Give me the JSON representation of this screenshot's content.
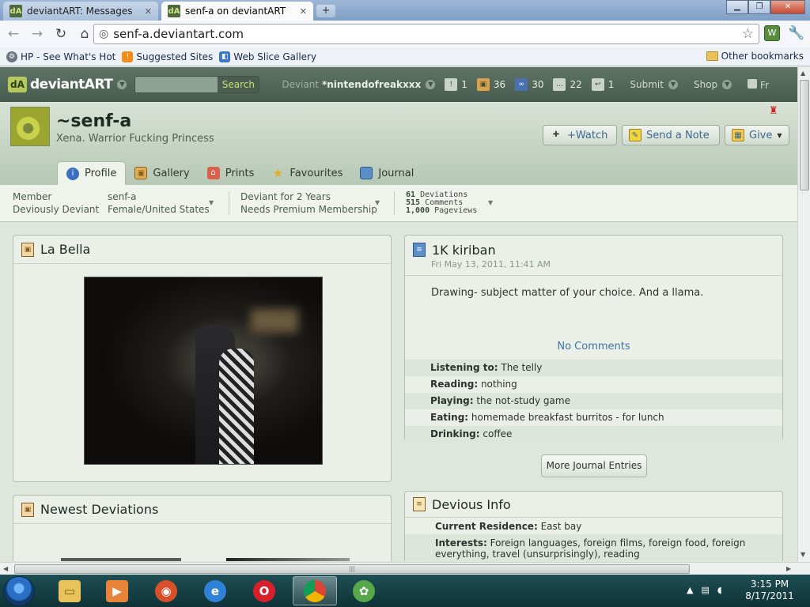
{
  "browser": {
    "tabs": [
      {
        "label": "deviantART: Messages",
        "active": false
      },
      {
        "label": "senf-a on deviantART",
        "active": true
      }
    ],
    "url": "senf-a.deviantart.com",
    "bookmarks": [
      "HP - See What's Hot",
      "Suggested Sites",
      "Web Slice Gallery"
    ],
    "other_bookmarks": "Other bookmarks"
  },
  "da_bar": {
    "logo": "deviantART",
    "search_button": "Search",
    "user_prefix": "Deviant",
    "username": "*nintendofreakxxx",
    "counts": [
      "1",
      "36",
      "30",
      "22",
      "1"
    ],
    "submit": "Submit",
    "shop": "Shop",
    "overflow": "Fr"
  },
  "profile": {
    "name": "~senf-a",
    "tagline": "Xena. Warrior Fucking Princess",
    "buttons": {
      "watch": "+Watch",
      "note": "Send a Note",
      "give": "Give"
    },
    "tabs": [
      "Profile",
      "Gallery",
      "Prints",
      "Favourites",
      "Journal"
    ]
  },
  "stats": {
    "member_line1": "Member",
    "member_line2": "Deviously Deviant",
    "user_line1": "senf-a",
    "user_line2": "Female/United States",
    "deviant_line1": "Deviant for 2 Years",
    "deviant_line2": "Needs Premium Membership",
    "deviations": "61",
    "deviations_label": "Deviations",
    "comments": "515",
    "comments_label": "Comments",
    "pageviews": "1,000",
    "pageviews_label": "Pageviews"
  },
  "featured": {
    "title": "La Bella"
  },
  "newest": {
    "title": "Newest Deviations"
  },
  "journal": {
    "title": "1K kiriban",
    "date": "Fri May 13, 2011, 11:41 AM",
    "body": "Drawing- subject matter of your choice. And a llama.",
    "comments": "No Comments",
    "moods": [
      {
        "label": "Listening to:",
        "value": "The telly"
      },
      {
        "label": "Reading:",
        "value": "nothing"
      },
      {
        "label": "Playing:",
        "value": "the not-study game"
      },
      {
        "label": "Eating:",
        "value": "homemade breakfast burritos - for lunch"
      },
      {
        "label": "Drinking:",
        "value": "coffee"
      }
    ],
    "more": "More Journal Entries"
  },
  "devious_info": {
    "title": "Devious Info",
    "residence_label": "Current Residence:",
    "residence_value": "East bay",
    "interests_label": "Interests:",
    "interests_value": "Foreign languages, foreign films, foreign food, foreign everything, travel (unsurprisingly), reading"
  },
  "taskbar": {
    "time": "3:15 PM",
    "date": "8/17/2011"
  },
  "colors": {
    "da_bar": "#475c4f",
    "profile_bg": "#b7c8b5",
    "link": "#3b74a5",
    "taskbar": "#0f3236"
  }
}
